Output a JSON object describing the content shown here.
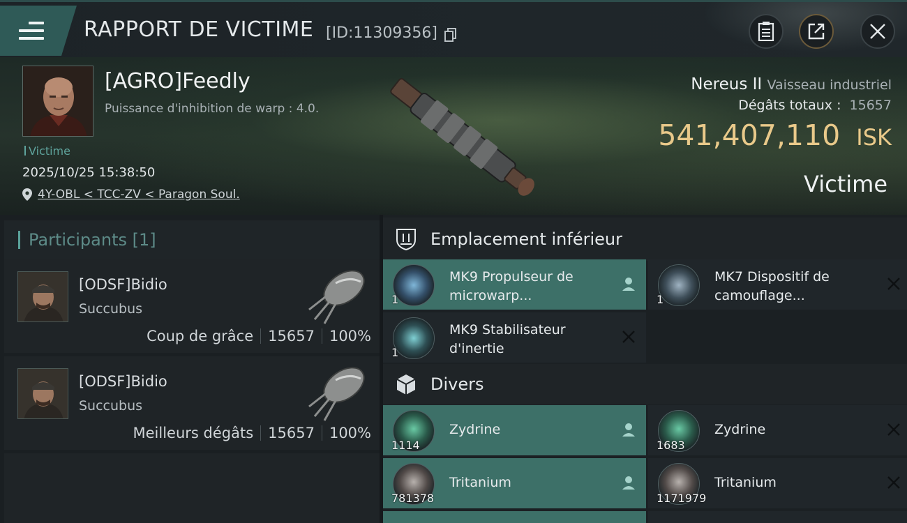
{
  "window": {
    "title": "RAPPORT DE VICTIME",
    "id_label": "[ID:11309356]",
    "buttons": [
      "notes-button",
      "share-button",
      "close-button"
    ]
  },
  "victim": {
    "name": "[AGRO]Feedly",
    "subtitle": "Puissance d'inhibition de warp : 4.0.",
    "role_tag": "Victime",
    "datetime": "2025/10/25 15:38:50",
    "location": "4Y-OBL < TCC-ZV < Paragon Soul.",
    "ship_name": "Nereus II",
    "ship_class": "Vaisseau industriel",
    "damage_label": "Dégâts totaux :",
    "damage_value": "15657",
    "isk_value": "541,407,110",
    "isk_unit": "ISK",
    "role_label": "Victime"
  },
  "participants": {
    "header": "Participants [1]",
    "items": [
      {
        "name": "[ODSF]Bidio",
        "ship": "Succubus",
        "label": "Coup de grâce",
        "damage": "15657",
        "percent": "100%"
      },
      {
        "name": "[ODSF]Bidio",
        "ship": "Succubus",
        "label": "Meilleurs dégâts",
        "damage": "15657",
        "percent": "100%"
      }
    ]
  },
  "fitting": {
    "low_slot": {
      "title": "Emplacement inférieur",
      "items": [
        {
          "name": "MK9 Propulseur de microwarp...",
          "qty": "1",
          "state": "dropped"
        },
        {
          "name": "MK7 Dispositif de camouflage...",
          "qty": "1",
          "state": "destroyed"
        },
        {
          "name": "MK9 Stabilisateur d'inertie",
          "qty": "1",
          "state": "destroyed"
        }
      ]
    },
    "misc": {
      "title": "Divers",
      "items": [
        {
          "name": "Zydrine",
          "qty": "1114",
          "state": "dropped"
        },
        {
          "name": "Zydrine",
          "qty": "1683",
          "state": "destroyed"
        },
        {
          "name": "Tritanium",
          "qty": "781378",
          "state": "dropped"
        },
        {
          "name": "Tritanium",
          "qty": "1171979",
          "state": "destroyed"
        }
      ]
    }
  },
  "colors": {
    "accent": "#3d7068",
    "isk": "#e9c98a",
    "panel": "#1f2427"
  }
}
